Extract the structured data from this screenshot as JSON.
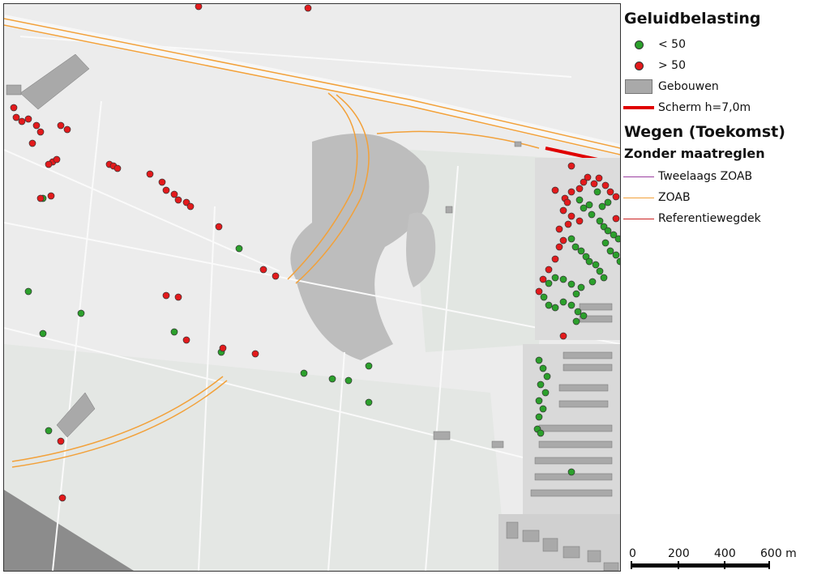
{
  "legend": {
    "title": "Geluidbelasting",
    "items": [
      {
        "label": "< 50",
        "symbol": "green-dot",
        "color": "#2ca02c"
      },
      {
        "label": "> 50",
        "symbol": "red-dot",
        "color": "#e31a1c"
      },
      {
        "label": "Gebouwen",
        "symbol": "grey-box",
        "color": "#a9a9a9"
      },
      {
        "label": "Scherm h=7,0m",
        "symbol": "red-line",
        "color": "#e00000"
      }
    ],
    "roads_title": "Wegen (Toekomst)",
    "roads_subtitle": "Zonder maatreglen",
    "road_items": [
      {
        "label": "Tweelaags ZOAB",
        "color": "#9b3fa0"
      },
      {
        "label": "ZOAB",
        "color": "#f2a13a"
      },
      {
        "label": "Referentiewegdek",
        "color": "#cc2222"
      }
    ]
  },
  "scalebar": {
    "labels": [
      "0",
      "200",
      "400",
      "600 m"
    ]
  },
  "map": {
    "background_color": "#ececec",
    "green_point_color": "#2ca02c",
    "red_point_color": "#e31a1c",
    "zoab_color": "#f2a13a",
    "screen_color": "#e00000"
  }
}
